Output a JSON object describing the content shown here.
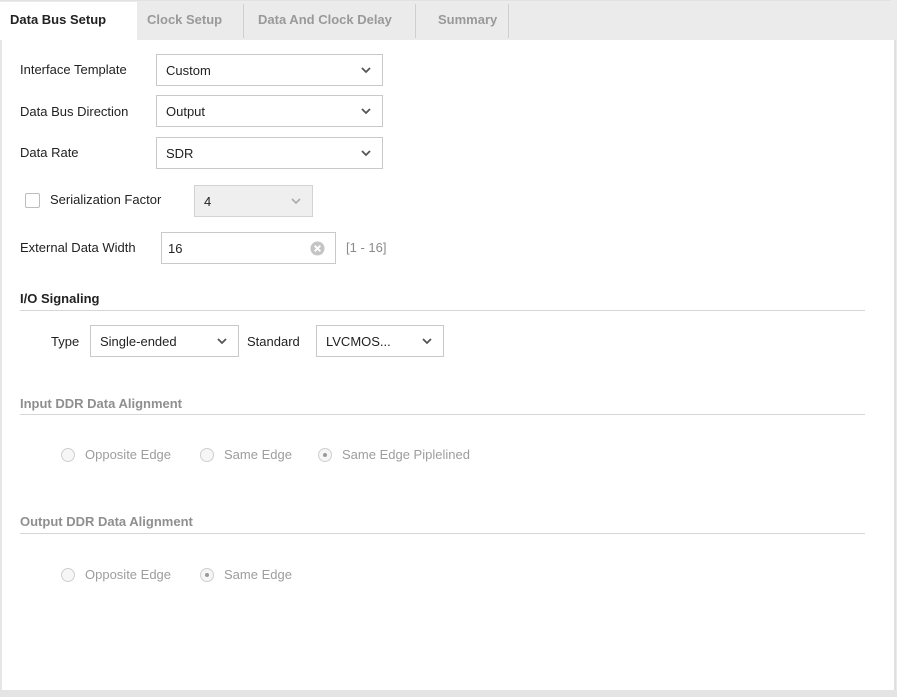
{
  "tabs": [
    {
      "label": "Data Bus Setup",
      "active": true
    },
    {
      "label": "Clock Setup",
      "active": false
    },
    {
      "label": "Data And Clock Delay",
      "active": false
    },
    {
      "label": "Summary",
      "active": false
    }
  ],
  "form": {
    "interface_template": {
      "label": "Interface Template",
      "value": "Custom"
    },
    "data_bus_direction": {
      "label": "Data Bus Direction",
      "value": "Output"
    },
    "data_rate": {
      "label": "Data Rate",
      "value": "SDR"
    },
    "serialization_factor": {
      "label": "Serialization Factor",
      "checked": false,
      "value": "4",
      "enabled": false
    },
    "external_data_width": {
      "label": "External Data Width",
      "value": "16",
      "range": "[1 - 16]"
    }
  },
  "io_signaling": {
    "title": "I/O Signaling",
    "type": {
      "label": "Type",
      "value": "Single-ended"
    },
    "standard": {
      "label": "Standard",
      "value": "LVCMOS..."
    }
  },
  "input_ddr": {
    "title": "Input DDR Data Alignment",
    "enabled": false,
    "options": [
      {
        "label": "Opposite Edge",
        "checked": false
      },
      {
        "label": "Same Edge",
        "checked": false
      },
      {
        "label": "Same Edge Piplelined",
        "checked": true
      }
    ]
  },
  "output_ddr": {
    "title": "Output DDR Data Alignment",
    "enabled": false,
    "options": [
      {
        "label": "Opposite Edge",
        "checked": false
      },
      {
        "label": "Same Edge",
        "checked": true
      }
    ]
  }
}
